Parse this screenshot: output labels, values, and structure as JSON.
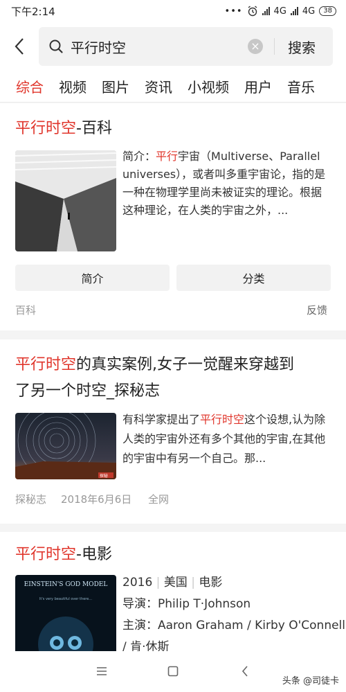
{
  "status": {
    "time": "下午2:14",
    "net1": "4G",
    "net2": "4G",
    "battery": "38"
  },
  "search": {
    "query": "平行时空",
    "button": "搜索"
  },
  "tabs": [
    "综合",
    "视频",
    "图片",
    "资讯",
    "小视频",
    "用户",
    "音乐"
  ],
  "results": [
    {
      "title_hl": "平行时空",
      "title_rest": "-百科",
      "desc_prefix": "简介：",
      "desc_hl": "平行",
      "desc_rest": "宇宙（Multiverse、Parallel universes），或者叫多重宇宙论，指的是一种在物理学里尚未被证实的理论。根据这种理论，在人类的宇宙之外，...",
      "btn_left": "简介",
      "btn_right": "分类",
      "source": "百科",
      "feedback": "反馈"
    },
    {
      "title_hl": "平行时空",
      "title_rest1": "的真实案例,女子一觉醒来穿越到",
      "title_rest2": "了另一个时空_探秘志",
      "desc_a": "有科学家提出了",
      "desc_hl": "平行时空",
      "desc_b": "这个设想,认为除人类的宇宙外还有多个其他的宇宙,在其他的宇宙中有另一个自己。那...",
      "source": "探秘志",
      "date": "2018年6月6日",
      "scope": "全网",
      "thumb_badge": "探秘"
    },
    {
      "title_hl": "平行时空",
      "title_rest": "-电影",
      "year": "2016",
      "country": "美国",
      "kind": "电影",
      "director": "导演：Philip T·Johnson",
      "cast1": "主演：Aaron Graham / Kirby O'Connell",
      "cast2": "/ 肯·休斯",
      "poster_title": "EINSTEIN'S GOD MODEL",
      "poster_tag": "It's very beautiful over there..."
    }
  ],
  "watermark": "头条 @司徒卡"
}
